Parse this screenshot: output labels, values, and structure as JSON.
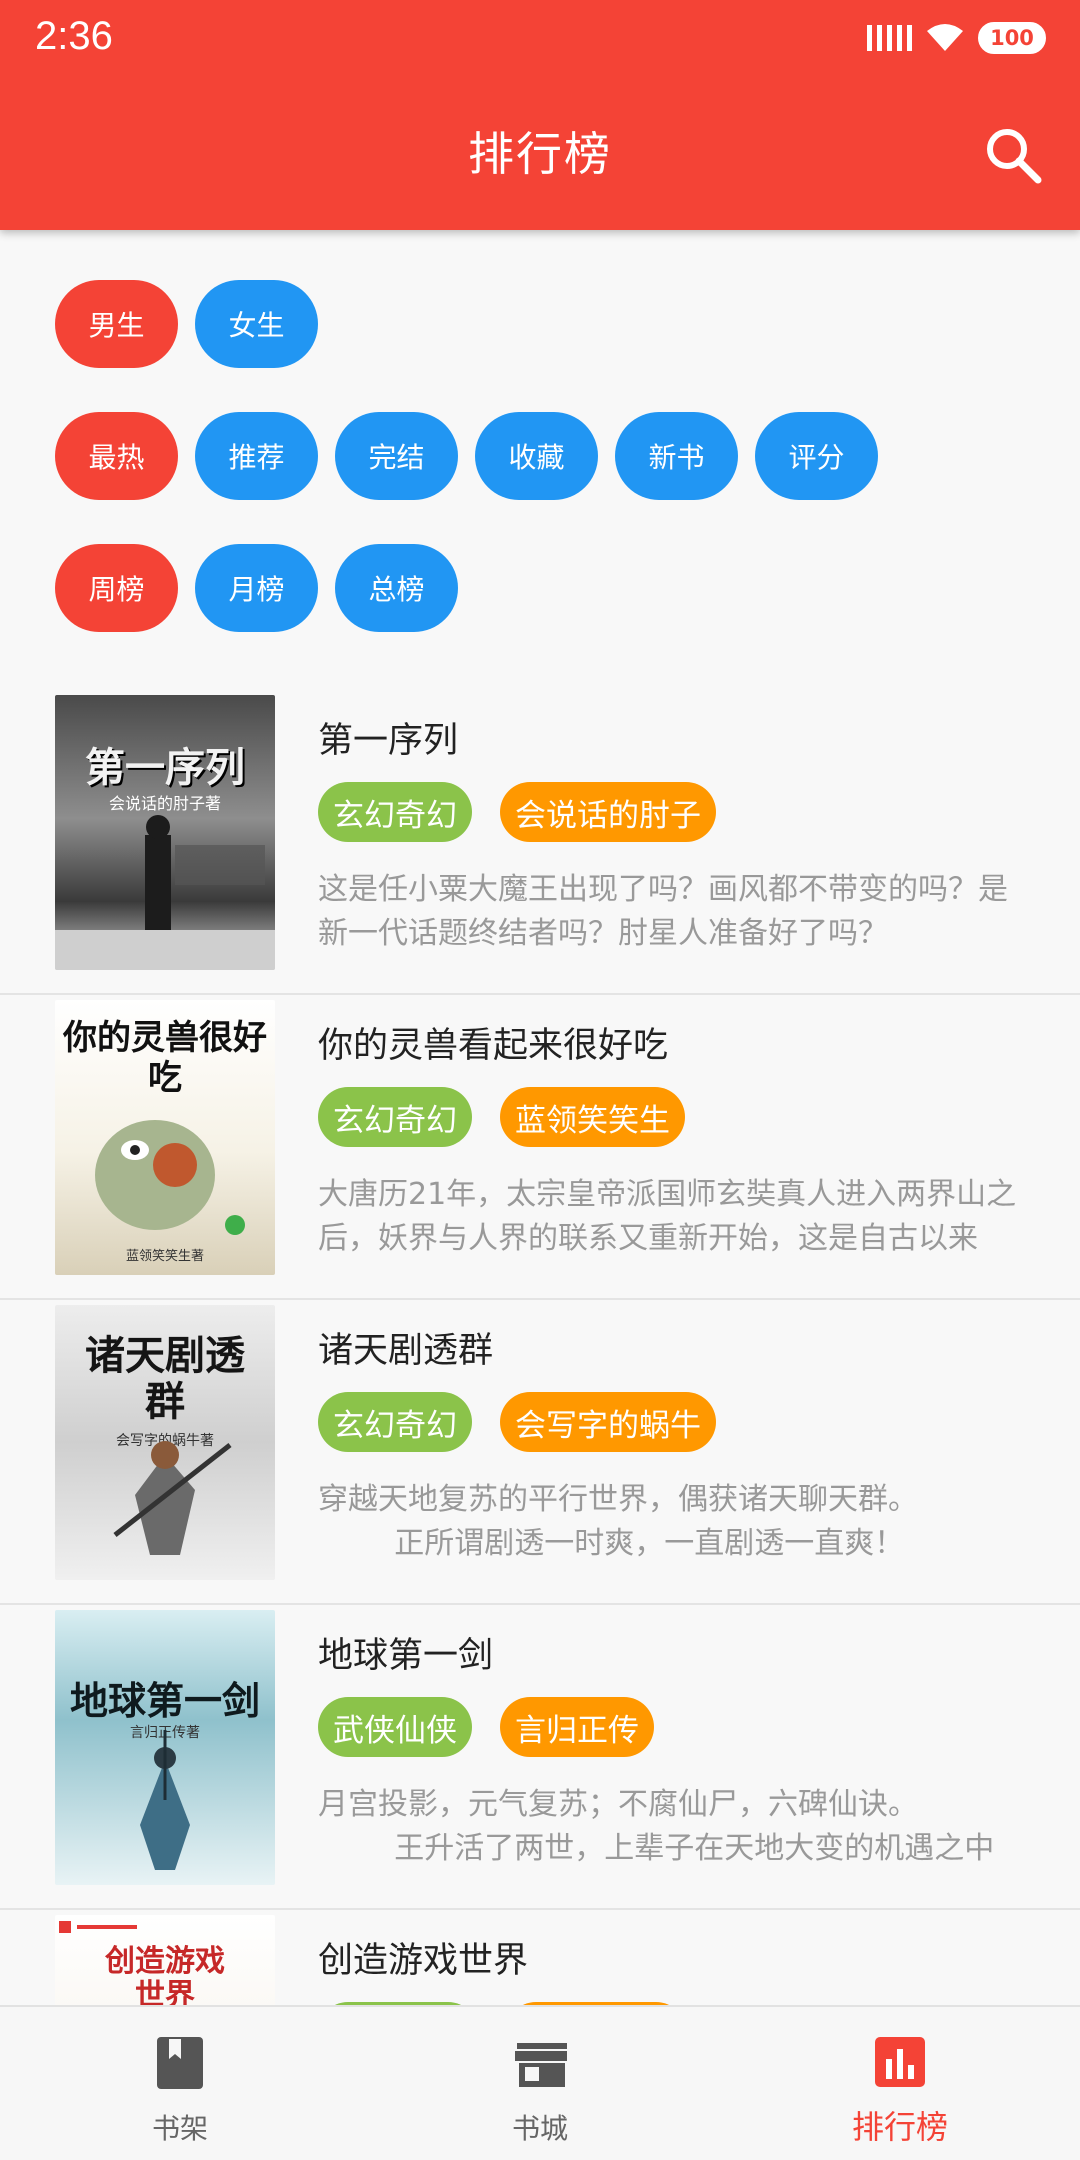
{
  "status_bar": {
    "time": "2:36",
    "battery": "100"
  },
  "toolbar": {
    "title": "排行榜",
    "search_icon": "search-icon"
  },
  "filters": {
    "gender": [
      {
        "label": "男生",
        "active": true
      },
      {
        "label": "女生",
        "active": false
      }
    ],
    "category": [
      {
        "label": "最热",
        "active": true
      },
      {
        "label": "推荐",
        "active": false
      },
      {
        "label": "完结",
        "active": false
      },
      {
        "label": "收藏",
        "active": false
      },
      {
        "label": "新书",
        "active": false
      },
      {
        "label": "评分",
        "active": false
      }
    ],
    "period": [
      {
        "label": "周榜",
        "active": true
      },
      {
        "label": "月榜",
        "active": false
      },
      {
        "label": "总榜",
        "active": false
      }
    ]
  },
  "books": [
    {
      "title": "第一序列",
      "genre": "玄幻奇幻",
      "author": "会说话的肘子",
      "description": "这是任小粟大魔王出现了吗？画风都不带变的吗？是新一代话题终结者吗？肘星人准备好了吗？",
      "cover_text": "第一序列",
      "cover_sub": "会说话的肘子著"
    },
    {
      "title": "你的灵兽看起来很好吃",
      "genre": "玄幻奇幻",
      "author": "蓝领笑笑生",
      "description": "大唐历21年，太宗皇帝派国师玄奘真人进入两界山之后，妖界与人界的联系又重新开始，这是自古以来",
      "cover_text": "你的灵兽很好吃",
      "cover_sub": "蓝领笑笑生著"
    },
    {
      "title": "诸天剧透群",
      "genre": "玄幻奇幻",
      "author": "会写字的蜗牛",
      "description": "穿越天地复苏的平行世界，偶获诸天聊天群。\n        正所谓剧透一时爽，一直剧透一直爽！",
      "cover_text": "诸天剧透群",
      "cover_sub": "会写字的蜗牛著"
    },
    {
      "title": "地球第一剑",
      "genre": "武侠仙侠",
      "author": "言归正传",
      "description": "月宫投影，元气复苏；不腐仙尸，六碑仙诀。\n        王升活了两世，上辈子在天地大变的机遇之中",
      "cover_text": "地球第一剑",
      "cover_sub": "言归正传著"
    },
    {
      "title": "创造游戏世界",
      "genre": "",
      "author": "",
      "description": "",
      "cover_text": "创造游戏世界",
      "cover_sub": ""
    }
  ],
  "bottom_nav": [
    {
      "label": "书架",
      "icon": "bookshelf-icon",
      "active": false
    },
    {
      "label": "书城",
      "icon": "store-icon",
      "active": false
    },
    {
      "label": "排行榜",
      "icon": "ranking-icon",
      "active": true
    }
  ],
  "colors": {
    "primary": "#f44336",
    "chip_inactive": "#2196f3",
    "genre_tag": "#8bc34a",
    "author_tag": "#ff9800"
  }
}
